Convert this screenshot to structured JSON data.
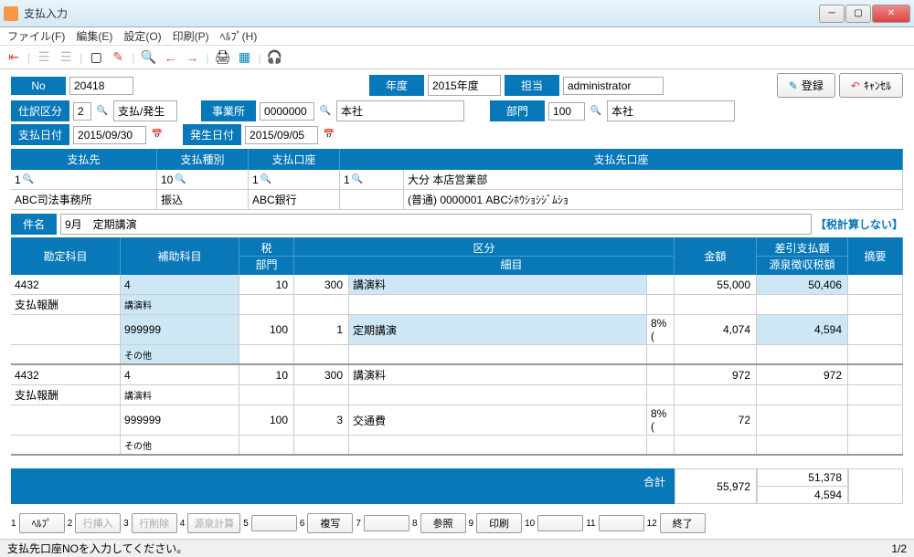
{
  "window": {
    "title": "支払入力"
  },
  "menu": {
    "file": "ファイル(F)",
    "edit": "編集(E)",
    "settings": "設定(O)",
    "print": "印刷(P)",
    "help": "ﾍﾙﾌﾟ(H)"
  },
  "actions": {
    "register": "登録",
    "cancel": "ｷｬﾝｾﾙ"
  },
  "header": {
    "no_label": "No",
    "no": "20418",
    "year_label": "年度",
    "year": "2015年度",
    "person_label": "担当",
    "person": "administrator",
    "shiwake_label": "仕訳区分",
    "shiwake_code": "2",
    "shiwake_name": "支払/発生",
    "office_label": "事業所",
    "office_code": "0000000",
    "office_name": "本社",
    "dept_label": "部門",
    "dept_code": "100",
    "dept_name": "本社",
    "pay_date_label": "支払日付",
    "pay_date": "2015/09/30",
    "occur_date_label": "発生日付",
    "occur_date": "2015/09/05"
  },
  "payee_headers": {
    "payee": "支払先",
    "paytype": "支払種別",
    "payacct": "支払口座",
    "payee_acct": "支払先口座"
  },
  "payee": {
    "payee_code": "1",
    "paytype_code": "10",
    "payacct_code": "1",
    "payee_acct_code": "1",
    "payee_name": "ABC司法事務所",
    "paytype_name": "振込",
    "payacct_name": "ABC銀行",
    "branch": "大分  本店営業部",
    "acct_detail": "(普通) 0000001 ABCｼﾎｳｼｮｼｼﾞﾑｼｮ"
  },
  "subject": {
    "label": "件名",
    "value": "9月　定期講演"
  },
  "tax_note": "【税計算しない】",
  "table_headers": {
    "account": "勘定科目",
    "sub": "補助科目",
    "tax": "税",
    "dept": "部門",
    "category": "区分",
    "detail": "細目",
    "amount": "金額",
    "net": "差引支払額",
    "withholding": "源泉徴収税額",
    "remarks": "摘要"
  },
  "rows": [
    {
      "acct_code": "4432",
      "acct_name": "支払報酬",
      "sub_code": "4",
      "sub_name": "講演料",
      "sub2_code": "999999",
      "sub2_name": "その他",
      "tax": "10",
      "dept": "100",
      "cat": "300",
      "cat2": "1",
      "detail": "講演料",
      "detail2": "定期講演",
      "amount": "55,000",
      "amount2": "4,074",
      "net": "50,406",
      "withholding": "4,594",
      "taxnote": "8%("
    },
    {
      "acct_code": "4432",
      "acct_name": "支払報酬",
      "sub_code": "4",
      "sub_name": "講演料",
      "sub2_code": "999999",
      "sub2_name": "その他",
      "tax": "10",
      "dept": "100",
      "cat": "300",
      "cat2": "3",
      "detail": "講演料",
      "detail2": "交通費",
      "amount": "972",
      "amount2": "72",
      "net": "972",
      "withholding": "",
      "taxnote": "8%("
    }
  ],
  "totals": {
    "label": "合計",
    "amount": "55,972",
    "net": "51,378",
    "withholding": "4,594"
  },
  "footer_btns": [
    "ﾍﾙﾌﾟ",
    "行挿入",
    "行削除",
    "源泉計算",
    "",
    "複写",
    "",
    "参照",
    "印刷",
    "",
    "",
    "終了"
  ],
  "status": {
    "msg": "支払先口座NOを入力してください。",
    "page": "1/2"
  }
}
